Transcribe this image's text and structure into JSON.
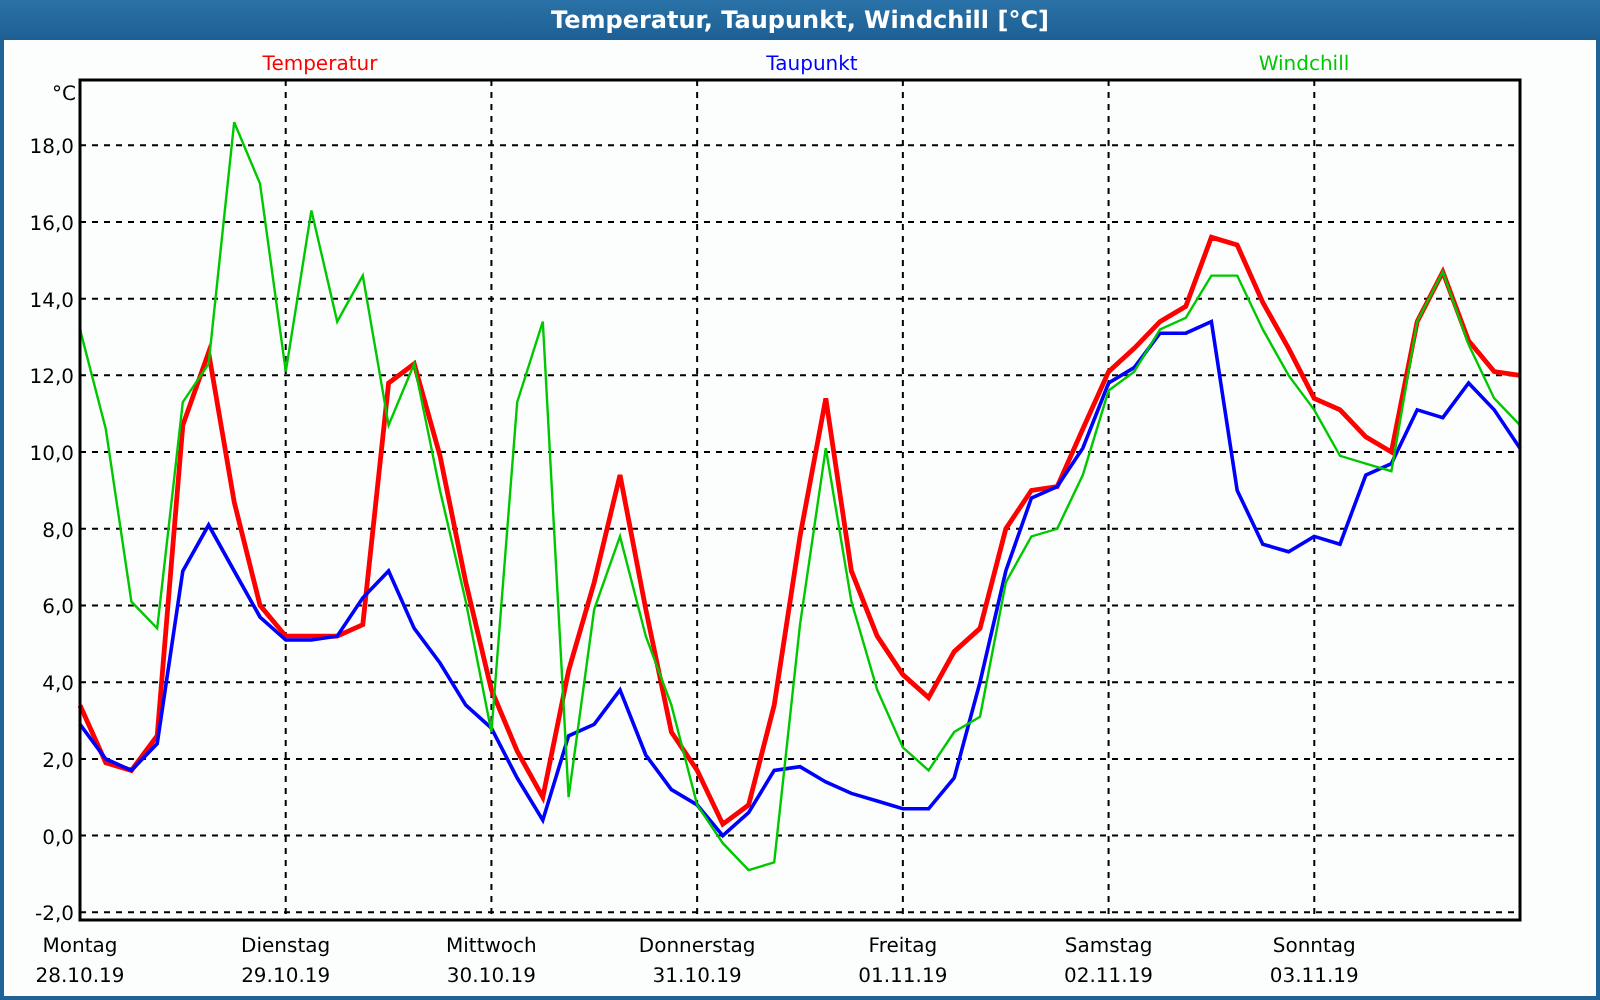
{
  "window": {
    "title": "Temperatur, Taupunkt, Windchill [°C]"
  },
  "chart_data": {
    "type": "line",
    "grid": true,
    "ylabel": "°C",
    "ylim": [
      -2.2,
      19.7
    ],
    "categories": [
      "Montag 28.10.19",
      null,
      null,
      null,
      null,
      null,
      null,
      null,
      "Dienstag 29.10.19",
      null,
      null,
      null,
      null,
      null,
      null,
      null,
      "Mittwoch 30.10.19",
      null,
      null,
      null,
      null,
      null,
      null,
      null,
      "Donnerstag 31.10.19",
      null,
      null,
      null,
      null,
      null,
      null,
      null,
      "Freitag 01.11.19",
      null,
      null,
      null,
      null,
      null,
      null,
      null,
      "Samstag 02.11.19",
      null,
      null,
      null,
      null,
      null,
      null,
      null,
      "Sonntag 03.11.19",
      null,
      null,
      null,
      null,
      null,
      null,
      null,
      null
    ],
    "yticks": [
      {
        "value": -2,
        "label": "-2,0"
      },
      {
        "value": 0,
        "label": "0,0"
      },
      {
        "value": 2,
        "label": "2,0"
      },
      {
        "value": 4,
        "label": "4,0"
      },
      {
        "value": 6,
        "label": "6,0"
      },
      {
        "value": 8,
        "label": "8,0"
      },
      {
        "value": 10,
        "label": "10,0"
      },
      {
        "value": 12,
        "label": "12,0"
      },
      {
        "value": 14,
        "label": "14,0"
      },
      {
        "value": 16,
        "label": "16,0"
      },
      {
        "value": 18,
        "label": "18,0"
      }
    ],
    "series": [
      {
        "name": "Temperatur",
        "color": "#ff0000",
        "values": [
          3.4,
          1.9,
          1.7,
          2.6,
          10.7,
          12.6,
          8.7,
          6.0,
          5.2,
          5.2,
          5.2,
          5.5,
          11.8,
          12.3,
          9.9,
          6.6,
          3.8,
          2.2,
          1.0,
          4.3,
          6.6,
          9.4,
          5.9,
          2.7,
          1.7,
          0.3,
          0.8,
          3.4,
          7.8,
          11.4,
          6.9,
          5.2,
          4.2,
          3.6,
          4.8,
          5.4,
          8.0,
          9.0,
          9.1,
          10.6,
          12.1,
          12.7,
          13.4,
          13.8,
          15.6,
          15.4,
          13.9,
          12.7,
          11.4,
          11.1,
          10.4,
          10.0,
          13.4,
          14.7,
          12.9,
          12.1,
          12.0
        ]
      },
      {
        "name": "Taupunkt",
        "color": "#0000ff",
        "values": [
          2.9,
          2.0,
          1.7,
          2.4,
          6.9,
          8.1,
          6.9,
          5.7,
          5.1,
          5.1,
          5.2,
          6.2,
          6.9,
          5.4,
          4.5,
          3.4,
          2.8,
          1.5,
          0.4,
          2.6,
          2.9,
          3.8,
          2.1,
          1.2,
          0.8,
          0.0,
          0.6,
          1.7,
          1.8,
          1.4,
          1.1,
          0.9,
          0.7,
          0.7,
          1.5,
          4.0,
          6.9,
          8.8,
          9.1,
          10.1,
          11.8,
          12.2,
          13.1,
          13.1,
          13.4,
          9.0,
          7.6,
          7.4,
          7.8,
          7.6,
          9.4,
          9.7,
          11.1,
          10.9,
          11.8,
          11.1,
          10.1
        ]
      },
      {
        "name": "Windchill",
        "color": "#00c800",
        "values": [
          13.2,
          10.6,
          6.1,
          5.4,
          11.3,
          12.3,
          18.6,
          17.0,
          12.1,
          16.3,
          13.4,
          14.6,
          10.7,
          12.3,
          9.0,
          6.1,
          2.7,
          11.3,
          13.4,
          1.0,
          5.9,
          7.8,
          5.2,
          3.4,
          0.8,
          -0.2,
          -0.9,
          -0.7,
          5.5,
          10.1,
          6.1,
          3.8,
          2.3,
          1.7,
          2.7,
          3.1,
          6.6,
          7.8,
          8.0,
          9.4,
          11.6,
          12.1,
          13.2,
          13.5,
          14.6,
          14.6,
          13.2,
          12.0,
          11.1,
          9.9,
          9.7,
          9.5,
          13.4,
          14.7,
          12.8,
          11.4,
          10.7
        ]
      }
    ]
  }
}
